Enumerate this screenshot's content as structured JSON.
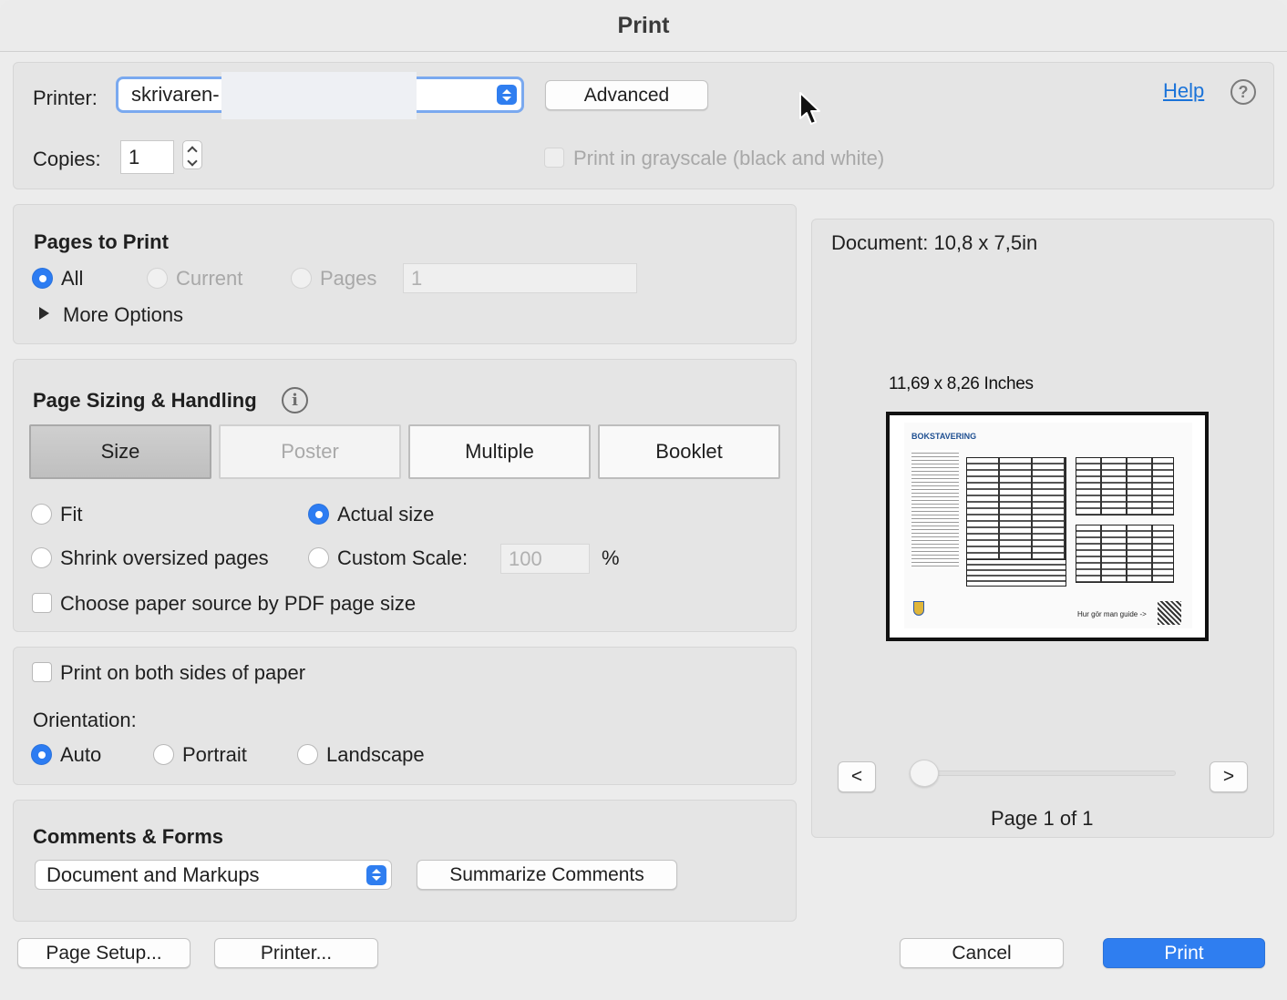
{
  "window": {
    "title": "Print"
  },
  "printer": {
    "label": "Printer:",
    "selected": "skrivaren-",
    "advanced_label": "Advanced",
    "help_label": "Help",
    "copies_label": "Copies:",
    "copies_value": "1",
    "grayscale_label": "Print in grayscale (black and white)"
  },
  "pages_to_print": {
    "title": "Pages to Print",
    "all_label": "All",
    "current_label": "Current",
    "pages_label": "Pages",
    "pages_value": "1",
    "more_options_label": "More Options"
  },
  "sizing": {
    "title": "Page Sizing & Handling",
    "tabs": [
      "Size",
      "Poster",
      "Multiple",
      "Booklet"
    ],
    "fit_label": "Fit",
    "actual_size_label": "Actual size",
    "shrink_label": "Shrink oversized pages",
    "custom_scale_label": "Custom Scale:",
    "custom_scale_value": "100",
    "percent": "%",
    "paper_source_label": "Choose paper source by PDF page size"
  },
  "duplex": {
    "both_sides_label": "Print on both sides of paper",
    "orientation_label": "Orientation:",
    "auto_label": "Auto",
    "portrait_label": "Portrait",
    "landscape_label": "Landscape"
  },
  "comments": {
    "title": "Comments & Forms",
    "selected": "Document and Markups",
    "summarize_label": "Summarize Comments"
  },
  "preview": {
    "document_size": "Document: 10,8 x 7,5in",
    "paper_size": "11,69 x 8,26 Inches",
    "prev_label": "<",
    "next_label": ">",
    "page_indicator": "Page 1 of 1",
    "thumb_heading": "BOKSTAVERING",
    "thumb_footer": "Hur gör man guide ->"
  },
  "footer": {
    "page_setup_label": "Page Setup...",
    "printer_label": "Printer...",
    "cancel_label": "Cancel",
    "print_label": "Print"
  },
  "colors": {
    "accent": "#2f7ef0",
    "link": "#1a73d9"
  }
}
